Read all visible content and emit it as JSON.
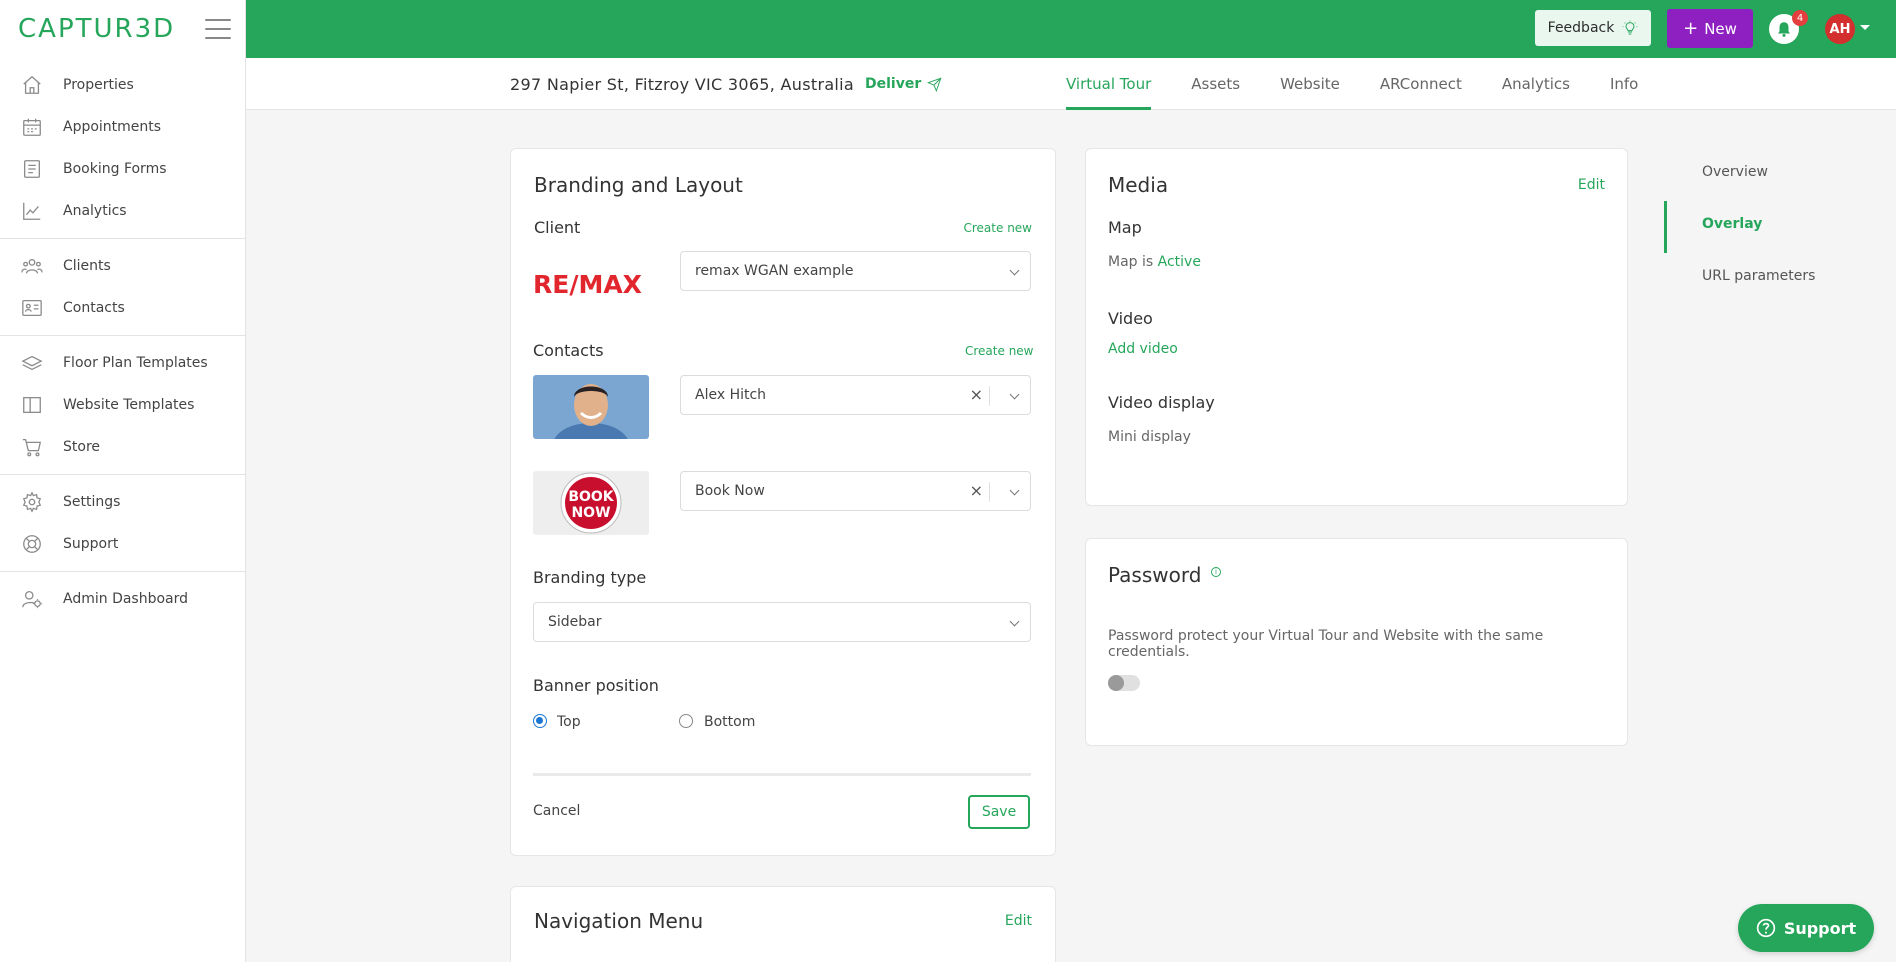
{
  "app": {
    "logo": "CAPTUR3D"
  },
  "sidebar": {
    "groups": [
      [
        {
          "label": "Properties",
          "icon": "home-icon"
        },
        {
          "label": "Appointments",
          "icon": "calendar-icon"
        },
        {
          "label": "Booking Forms",
          "icon": "form-icon"
        },
        {
          "label": "Analytics",
          "icon": "chart-icon"
        }
      ],
      [
        {
          "label": "Clients",
          "icon": "users-icon"
        },
        {
          "label": "Contacts",
          "icon": "contact-card-icon"
        }
      ],
      [
        {
          "label": "Floor Plan Templates",
          "icon": "layers-icon"
        },
        {
          "label": "Website Templates",
          "icon": "columns-icon"
        },
        {
          "label": "Store",
          "icon": "cart-icon"
        }
      ],
      [
        {
          "label": "Settings",
          "icon": "gear-icon"
        },
        {
          "label": "Support",
          "icon": "lifebuoy-icon"
        }
      ],
      [
        {
          "label": "Admin Dashboard",
          "icon": "admin-icon"
        }
      ]
    ]
  },
  "header": {
    "feedback_label": "Feedback",
    "new_label": "New",
    "notification_count": "4",
    "avatar_initials": "AH",
    "brand_color": "#26a65b"
  },
  "property": {
    "address": "297 Napier St, Fitzroy VIC 3065, Australia",
    "deliver_label": "Deliver"
  },
  "tabs": [
    "Virtual Tour",
    "Assets",
    "Website",
    "ARConnect",
    "Analytics",
    "Info"
  ],
  "branding": {
    "title": "Branding and Layout",
    "client_label": "Client",
    "create_new": "Create new",
    "client_value": "remax WGAN example",
    "client_logo_text": "RE/MAX",
    "contacts_label": "Contacts",
    "contact_1": "Alex Hitch",
    "contact_2": "Book Now",
    "book_now_badge_line1": "BOOK",
    "book_now_badge_line2": "NOW",
    "branding_type_label": "Branding type",
    "branding_type_value": "Sidebar",
    "banner_position_label": "Banner position",
    "banner_top": "Top",
    "banner_bottom": "Bottom",
    "cancel_label": "Cancel",
    "save_label": "Save"
  },
  "navigation_menu": {
    "title": "Navigation Menu",
    "edit_label": "Edit"
  },
  "media": {
    "title": "Media",
    "edit_label": "Edit",
    "map_label": "Map",
    "map_status_prefix": "Map is",
    "map_status": "Active",
    "video_label": "Video",
    "add_video": "Add video",
    "video_display_label": "Video display",
    "video_display_value": "Mini display"
  },
  "password": {
    "title": "Password",
    "description": "Password protect your Virtual Tour and Website with the same credentials."
  },
  "anchors": [
    "Overview",
    "Overlay",
    "URL parameters"
  ],
  "support_button": "Support"
}
